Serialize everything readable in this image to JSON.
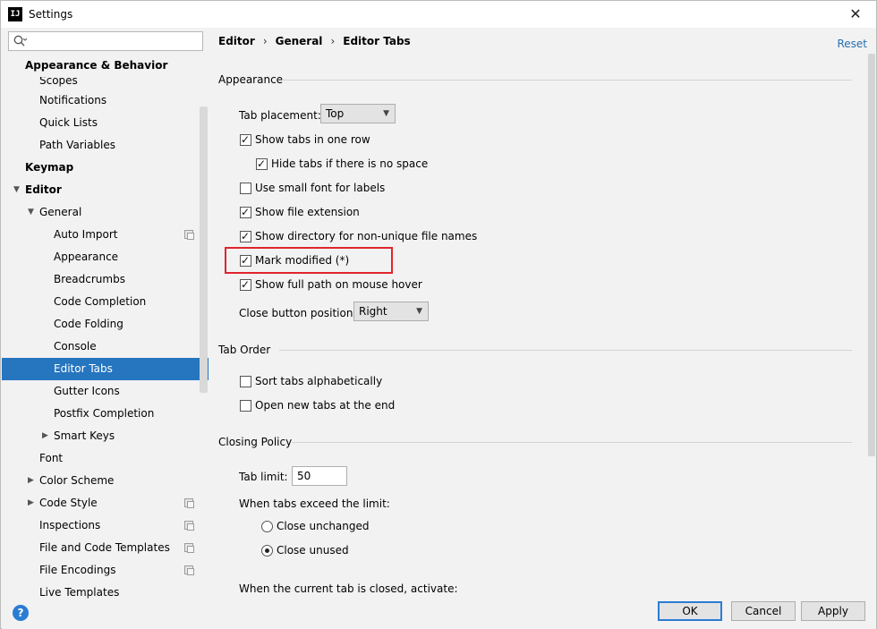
{
  "window": {
    "title": "Settings",
    "app_icon": "IJ"
  },
  "search": {
    "placeholder": "",
    "value": ""
  },
  "sidebar": {
    "items": [
      {
        "label": "Appearance & Behavior",
        "bold": true
      },
      {
        "label": "Scopes"
      },
      {
        "label": "Notifications"
      },
      {
        "label": "Quick Lists"
      },
      {
        "label": "Path Variables"
      },
      {
        "label": "Keymap",
        "bold": true
      },
      {
        "label": "Editor",
        "bold": true
      },
      {
        "label": "General"
      },
      {
        "label": "Auto Import"
      },
      {
        "label": "Appearance"
      },
      {
        "label": "Breadcrumbs"
      },
      {
        "label": "Code Completion"
      },
      {
        "label": "Code Folding"
      },
      {
        "label": "Console"
      },
      {
        "label": "Editor Tabs",
        "selected": true
      },
      {
        "label": "Gutter Icons"
      },
      {
        "label": "Postfix Completion"
      },
      {
        "label": "Smart Keys"
      },
      {
        "label": "Font"
      },
      {
        "label": "Color Scheme"
      },
      {
        "label": "Code Style"
      },
      {
        "label": "Inspections"
      },
      {
        "label": "File and Code Templates"
      },
      {
        "label": "File Encodings"
      },
      {
        "label": "Live Templates"
      }
    ]
  },
  "breadcrumb": {
    "items": [
      "Editor",
      "General",
      "Editor Tabs"
    ],
    "separator": "›"
  },
  "reset_label": "Reset",
  "appearance": {
    "title": "Appearance",
    "tab_placement_label": "Tab placement:",
    "tab_placement_value": "Top",
    "show_tabs_one_row": {
      "label": "Show tabs in one row",
      "checked": true
    },
    "hide_tabs_no_space": {
      "label": "Hide tabs if there is no space",
      "checked": true
    },
    "small_font": {
      "label": "Use small font for labels",
      "checked": false
    },
    "file_extension": {
      "label": "Show file extension",
      "checked": true
    },
    "directory_nonunique": {
      "label": "Show directory for non-unique file names",
      "checked": true
    },
    "mark_modified": {
      "label": "Mark modified (*)",
      "checked": true
    },
    "full_path_hover": {
      "label": "Show full path on mouse hover",
      "checked": true
    },
    "close_button_label": "Close button position:",
    "close_button_value": "Right"
  },
  "tab_order": {
    "title": "Tab Order",
    "sort_alpha": {
      "label": "Sort tabs alphabetically",
      "checked": false
    },
    "open_at_end": {
      "label": "Open new tabs at the end",
      "checked": false
    }
  },
  "closing_policy": {
    "title": "Closing Policy",
    "tab_limit_label": "Tab limit:",
    "tab_limit_value": "50",
    "exceed_label": "When tabs exceed the limit:",
    "close_unchanged": {
      "label": "Close unchanged",
      "selected": false
    },
    "close_unused": {
      "label": "Close unused",
      "selected": true
    },
    "when_closed_label": "When the current tab is closed, activate:"
  },
  "footer": {
    "help": "?",
    "ok": "OK",
    "cancel": "Cancel",
    "apply": "Apply"
  },
  "colors": {
    "accent": "#2675bf",
    "highlight": "#e0242b",
    "link": "#2470b3"
  },
  "check_glyph": "✓"
}
